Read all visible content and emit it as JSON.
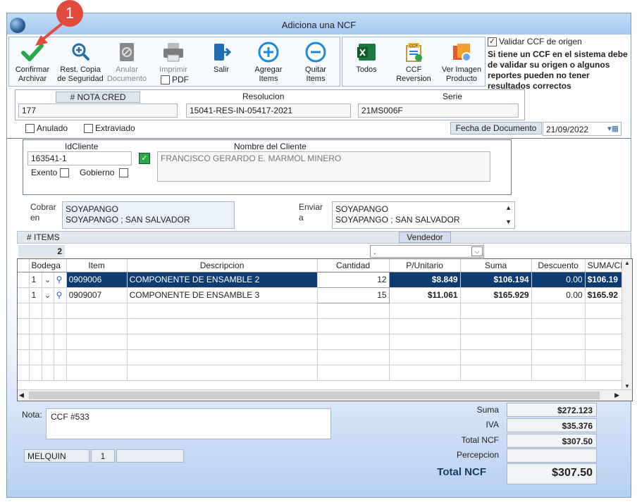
{
  "window": {
    "title": "Adiciona una NCF",
    "badge": "1"
  },
  "toolbar": {
    "confirm": "Confirmar\nArchivar",
    "restore": "Rest. Copia\nde Seguridad",
    "void": "Anular\nDocumento",
    "print": "Imprimir",
    "pdf": "PDF",
    "exit": "Salir",
    "add": "Agregar\nItems",
    "remove": "Quitar\nItems",
    "all": "Todos",
    "ccf_rev": "CCF\nReversion",
    "ccf_rev_badge": "CCF",
    "view_image": "Ver Imagen\nProducto"
  },
  "validate": {
    "label": "Validar CCF de origen",
    "warning": "Si tiene un CCF en el sistema debe de validar su origen o algunos reportes pueden no tener resultados correctos"
  },
  "header": {
    "nota_label": "# NOTA CRED",
    "nota_value": "177",
    "resol_label": "Resolucion",
    "resol_value": "15041-RES-IN-05417-2021",
    "serie_label": "Serie",
    "serie_value": "21MS006F"
  },
  "flags": {
    "anulado": "Anulado",
    "extraviado": "Extraviado",
    "fecha_label": "Fecha de  Documento",
    "fecha_value": "21/09/2022"
  },
  "client": {
    "id_label": "IdCliente",
    "id_value": "163541-1",
    "name_label": "Nombre del Cliente",
    "name_value": "FRANCISCO GERARDO E. MARMOL MINERO",
    "exento": "Exento",
    "gobierno": "Gobierno"
  },
  "address": {
    "cobrar_label": "Cobrar\nen",
    "cobrar_l1": "SOYAPANGO",
    "cobrar_l2": "SOYAPANGO ; SAN SALVADOR",
    "enviar_label": "Enviar\na",
    "enviar_l1": "SOYAPANGO",
    "enviar_l2": "SOYAPANGO ; SAN SALVADOR"
  },
  "items_bar": {
    "items_label": "# ITEMS",
    "items_count": "2",
    "vendedor_label": "Vendedor",
    "vendedor_value": "."
  },
  "table": {
    "columns": [
      "Bodega",
      "Item",
      "Descripcion",
      "Cantidad",
      "P/Unitario",
      "Suma",
      "Descuento",
      "SUMA/CD"
    ],
    "rows": [
      {
        "bodega": "1",
        "item": "0909006",
        "desc": "COMPONENTE DE ENSAMBLE 2",
        "cant": "12",
        "pu": "$8.849",
        "suma": "$106.194",
        "desc_amt": "0.00",
        "sumacd": "$106.19"
      },
      {
        "bodega": "1",
        "item": "0909007",
        "desc": "COMPONENTE DE ENSAMBLE 3",
        "cant": "15",
        "pu": "$11.061",
        "suma": "$165.929",
        "desc_amt": "0.00",
        "sumacd": "$165.92"
      }
    ]
  },
  "nota": {
    "label": "Nota:",
    "value": "CCF  #533"
  },
  "footer": {
    "user": "MELQUIN",
    "num": "1",
    "blank": ""
  },
  "totals": {
    "suma_label": "Suma",
    "suma": "$272.123",
    "iva_label": "IVA",
    "iva": "$35.376",
    "total_label": "Total NCF",
    "total": "$307.50",
    "percep_label": "Percepcion",
    "percep": "",
    "grand_label": "Total NCF",
    "grand": "$307.50"
  }
}
